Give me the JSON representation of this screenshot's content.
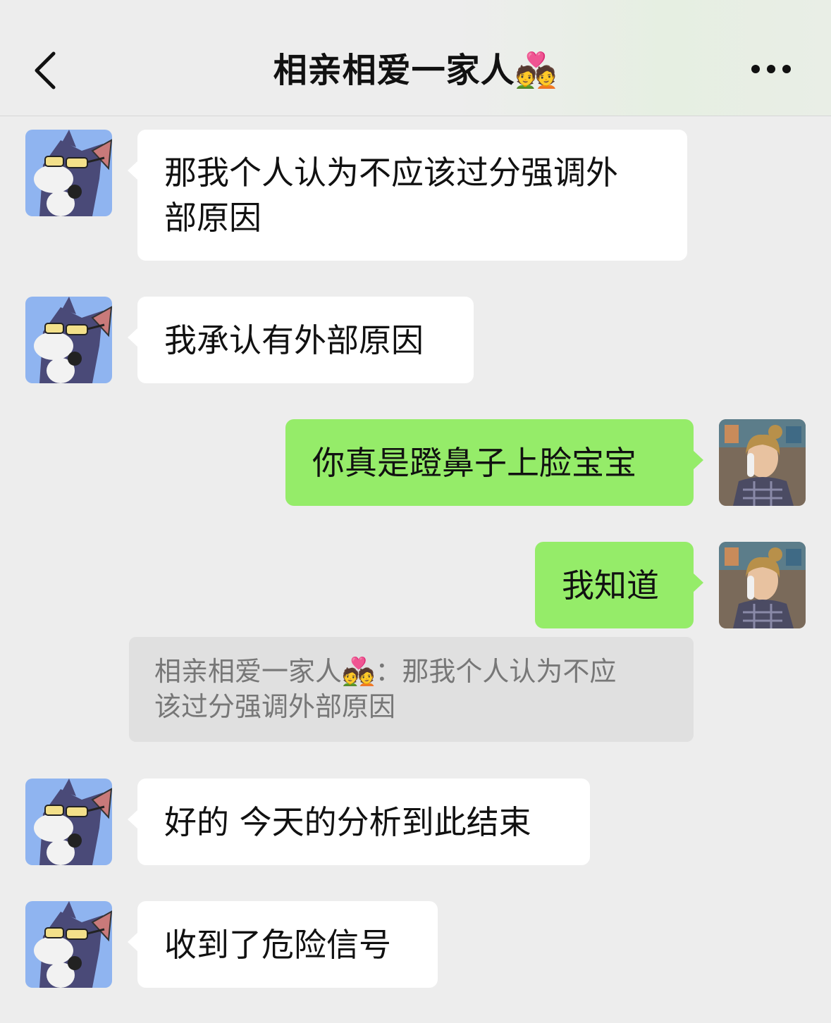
{
  "header": {
    "title": "相亲相爱一家人💑",
    "back_icon": "chevron-left-icon",
    "more_icon": "more-dots-icon"
  },
  "messages": [
    {
      "side": "left",
      "text_lines": [
        "那我个人认为不应该过分强调外",
        "部原因"
      ]
    },
    {
      "side": "left",
      "text": "我承认有外部原因"
    },
    {
      "side": "right",
      "text": "你真是蹬鼻子上脸宝宝"
    },
    {
      "side": "right",
      "text": "我知道"
    },
    {
      "side": "left",
      "text": "好的 今天的分析到此结束"
    },
    {
      "side": "left",
      "text": "收到了危险信号"
    }
  ],
  "quote": {
    "lines": [
      "相亲相爱一家人💑：那我个人认为不应",
      "该过分强调外部原因"
    ]
  },
  "colors": {
    "background": "#ededed",
    "self_bubble": "#95ec69",
    "other_bubble": "#ffffff",
    "quote_bg": "#e0e0e0",
    "quote_text": "#777777"
  }
}
